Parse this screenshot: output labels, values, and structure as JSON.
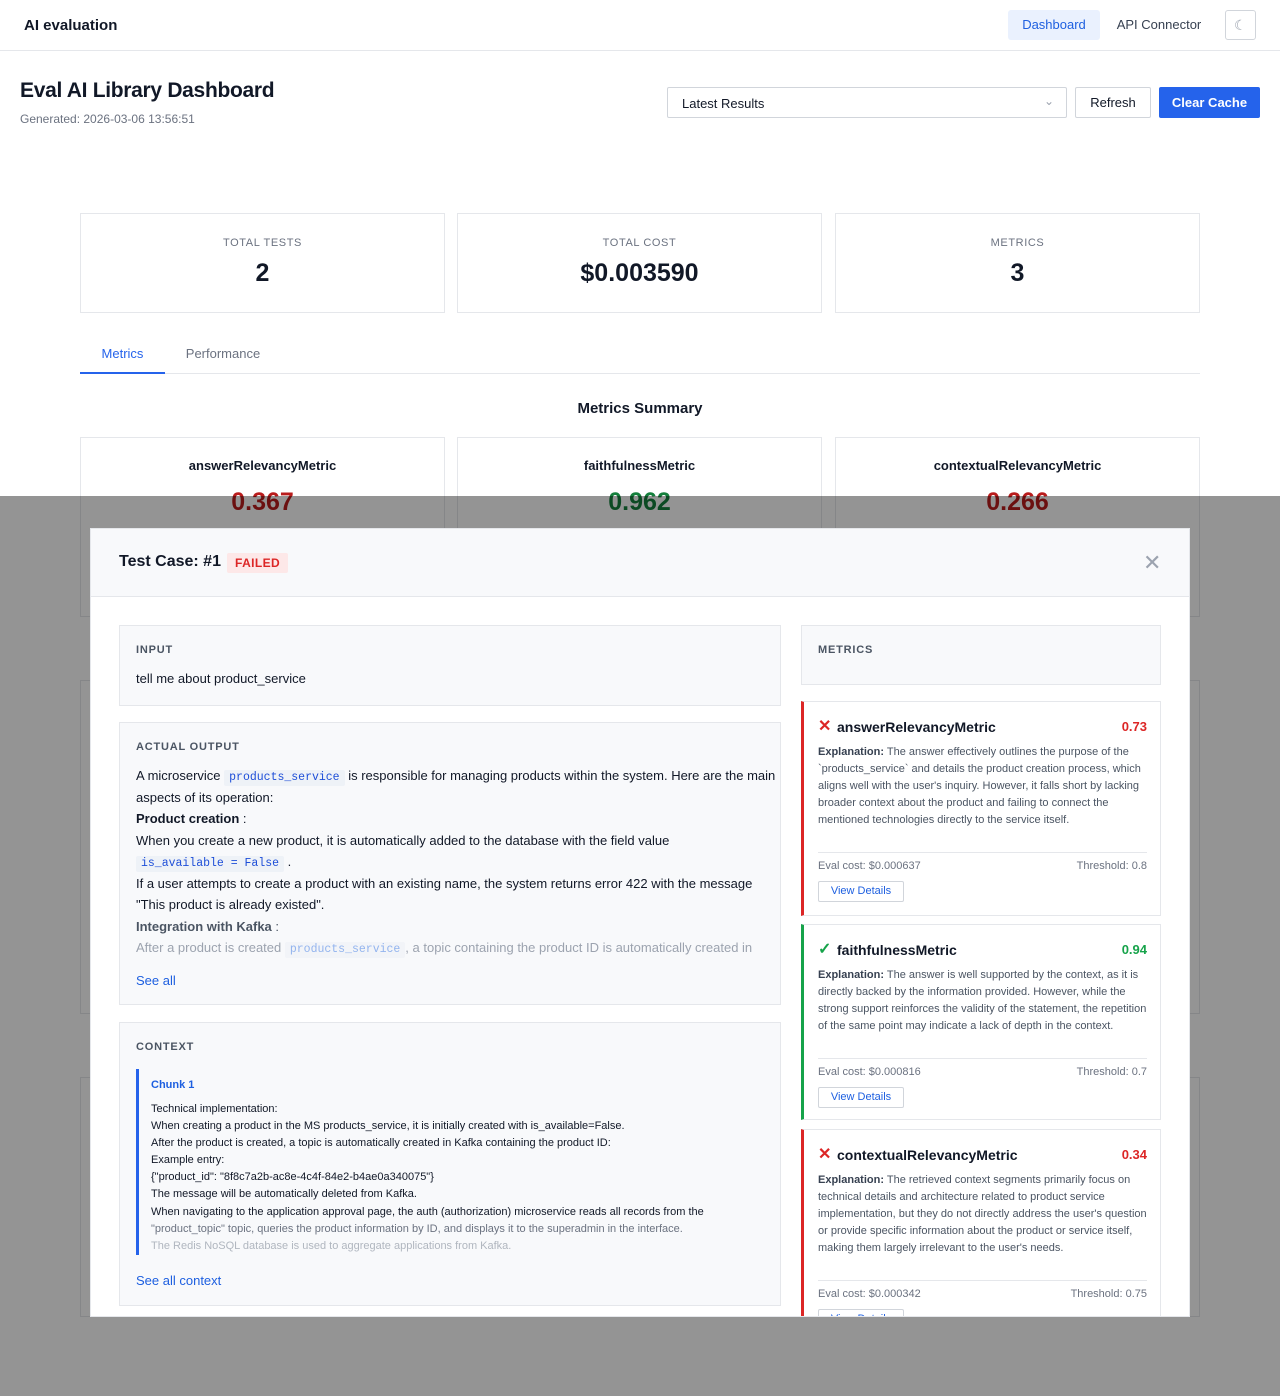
{
  "nav": {
    "brand": "AI evaluation",
    "dashboard": "Dashboard",
    "api_connector": "API Connector",
    "theme_icon": "moon-icon"
  },
  "header": {
    "title": "Eval AI Library Dashboard",
    "generated": "Generated: 2026-03-06 13:56:51",
    "select_value": "Latest Results",
    "refresh": "Refresh",
    "clear_cache": "Clear Cache"
  },
  "stats": [
    {
      "label": "TOTAL TESTS",
      "value": "2"
    },
    {
      "label": "TOTAL COST",
      "value": "$0.003590"
    },
    {
      "label": "METRICS",
      "value": "3"
    }
  ],
  "tabs": {
    "metrics": "Metrics",
    "performance": "Performance"
  },
  "summary": {
    "title": "Metrics Summary",
    "metrics": [
      {
        "name": "answerRelevancyMetric",
        "score": "0.367",
        "color": "#b91c1c"
      },
      {
        "name": "faithfulnessMetric",
        "score": "0.962",
        "color": "#15803d"
      },
      {
        "name": "contextualRelevancyMetric",
        "score": "0.266",
        "color": "#b91c1c"
      }
    ]
  },
  "modal": {
    "title": "Test Case: #1",
    "status": "FAILED",
    "input_label": "INPUT",
    "input": "tell me about product_service",
    "output_label": "ACTUAL OUTPUT",
    "output": {
      "p1_a": "A microservice",
      "p1_code": "products_service",
      "p1_b": "is responsible for managing products within the system. Here are the main aspects of its operation:",
      "h1": "Product creation",
      "h1_colon": " :",
      "p2_a": "When you create a new product, it is automatically added to the database with the field value",
      "p2_code": "is_available = False",
      "p2_b": " .",
      "p3": "If a user attempts to create a product with an existing name, the system returns error 422 with the message \"This product is already existed\".",
      "h2": "Integration with Kafka",
      "h2_colon": " :",
      "p4_a": "After a product is created",
      "p4_code": "products_service",
      "p4_b": ", a topic containing the product ID is automatically created in"
    },
    "see_all": "See all",
    "context_label": "CONTEXT",
    "chunk_label": "Chunk 1",
    "chunk_lines": [
      "Technical implementation:",
      "When creating a product in the MS products_service, it is initially created with is_available=False.",
      "After the product is created, a topic is automatically created in Kafka containing the product ID:",
      "Example entry:",
      "{\"product_id\": \"8f8c7a2b-ac8e-4c4f-84e2-b4ae0a340075\"}",
      "The message will be automatically deleted from Kafka.",
      "When navigating to the application approval page, the auth (authorization) microservice reads all records from the",
      "\"product_topic\" topic, queries the product information by ID, and displays it to the superadmin in the interface.",
      "The Redis NoSQL database is used to aggregate applications from Kafka."
    ],
    "see_all_context": "See all context",
    "metrics_label": "METRICS",
    "explanation_label": "Explanation:",
    "view_details": "View Details",
    "metric_results": [
      {
        "name": "answerRelevancyMetric",
        "score": "0.73",
        "passed": false,
        "explanation": "The answer effectively outlines the purpose of the `products_service` and details the product creation process, which aligns well with the user's inquiry. However, it falls short by lacking broader context about the product and failing to connect the mentioned technologies directly to the service itself.",
        "cost": "Eval cost: $0.000637",
        "threshold": "Threshold: 0.8"
      },
      {
        "name": "faithfulnessMetric",
        "score": "0.94",
        "passed": true,
        "explanation": "The answer is well supported by the context, as it is directly backed by the information provided. However, while the strong support reinforces the validity of the statement, the repetition of the same point may indicate a lack of depth in the context.",
        "cost": "Eval cost: $0.000816",
        "threshold": "Threshold: 0.7"
      },
      {
        "name": "contextualRelevancyMetric",
        "score": "0.34",
        "passed": false,
        "explanation": "The retrieved context segments primarily focus on technical details and architecture related to product service implementation, but they do not directly address the user's question or provide specific information about the product or service itself, making them largely irrelevant to the user's needs.",
        "cost": "Eval cost: $0.000342",
        "threshold": "Threshold: 0.75"
      }
    ]
  }
}
